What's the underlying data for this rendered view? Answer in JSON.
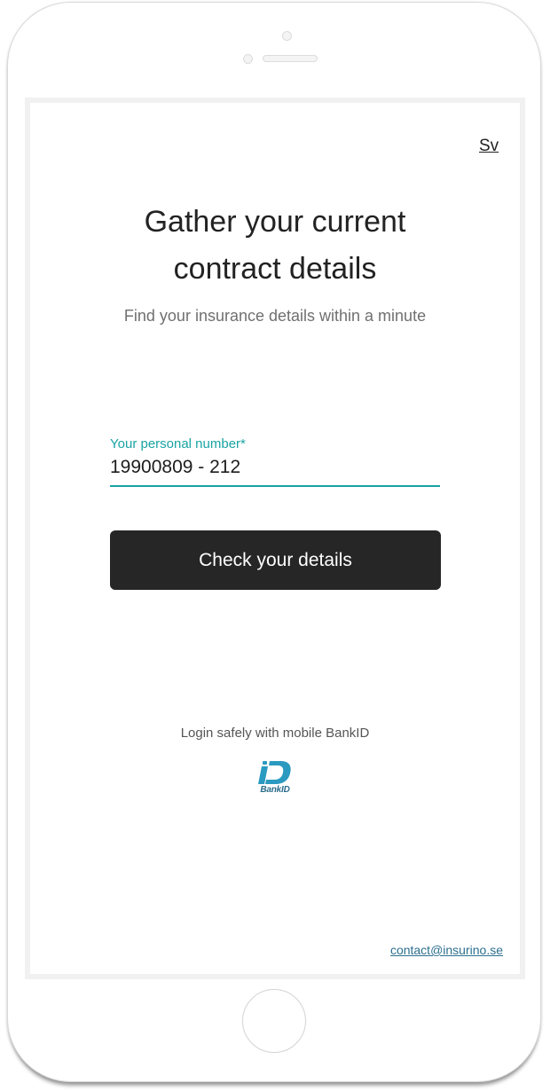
{
  "language_toggle": "Sv",
  "hero": {
    "title_line1": "Gather your current",
    "title_line2": "contract details",
    "subtitle": "Find your insurance details within a minute"
  },
  "form": {
    "personal_number_label": "Your personal number*",
    "personal_number_value": "19900809 - 212",
    "submit_label": "Check your details"
  },
  "bankid": {
    "caption": "Login safely with mobile BankID",
    "logo_text": "BankID",
    "logo_icon": "bankid-logo-icon"
  },
  "footer": {
    "contact_email": "contact@insurino.se"
  },
  "colors": {
    "accent": "#17a2a6",
    "button_bg": "#262626",
    "link": "#2c6f8f",
    "bankid_blue": "#2b9ac0"
  }
}
